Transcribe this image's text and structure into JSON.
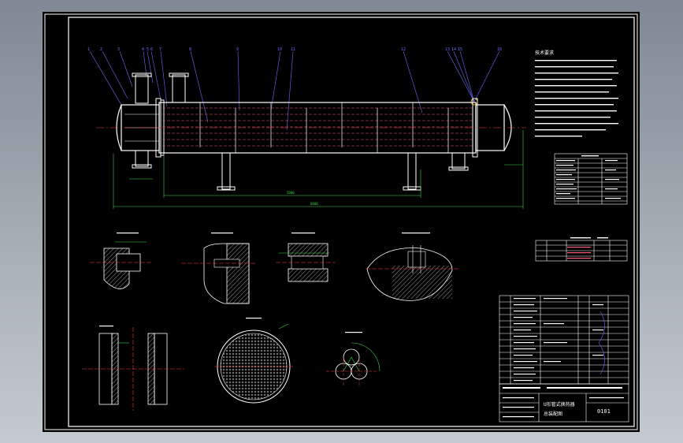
{
  "title_block": {
    "drawing_number": "0101",
    "name_line_1": "U形管式换热器",
    "name_line_2": "总装配图"
  },
  "notes": {
    "heading": "技术要求"
  }
}
